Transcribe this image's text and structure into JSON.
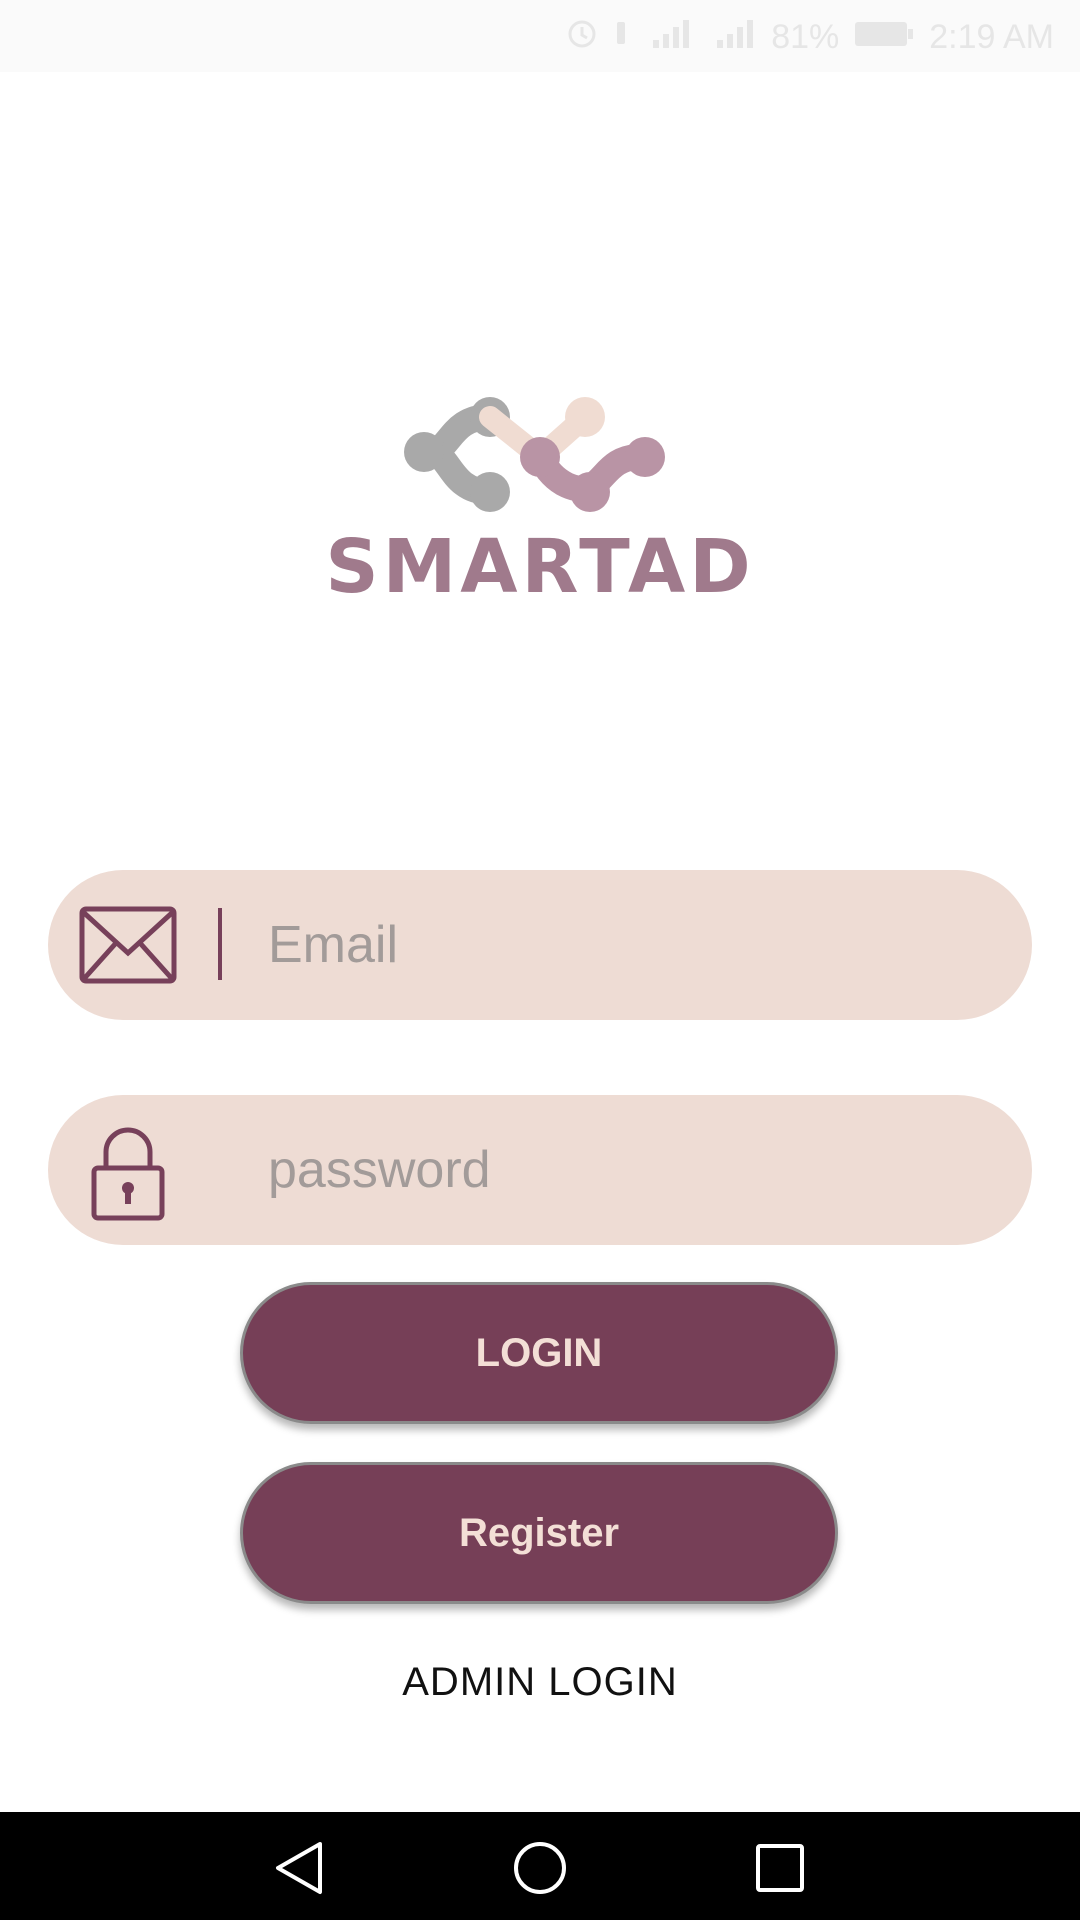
{
  "status_bar": {
    "battery": "81%",
    "time": "2:19 AM",
    "icons": [
      "alarm-icon",
      "vibrate-icon",
      "signal-icon",
      "signal-icon",
      "battery-icon"
    ]
  },
  "logo": {
    "text": "SMARTAD",
    "colors": {
      "gray": "#a9a9a9",
      "peach": "#f0dcd2",
      "mauve": "#b994a5",
      "text": "#a07a8c"
    }
  },
  "form": {
    "email": {
      "placeholder": "Email",
      "value": "",
      "icon": "envelope-icon"
    },
    "password": {
      "placeholder": "password",
      "value": "",
      "icon": "lock-icon"
    }
  },
  "buttons": {
    "login": "LOGIN",
    "register": "Register"
  },
  "admin_link": "ADMIN LOGIN",
  "navigation": {
    "icons": [
      "back-icon",
      "home-icon",
      "recents-icon"
    ]
  },
  "colors": {
    "accent": "#763f57",
    "field_bg": "#eedcd4",
    "button_text": "#f3dfd6"
  }
}
